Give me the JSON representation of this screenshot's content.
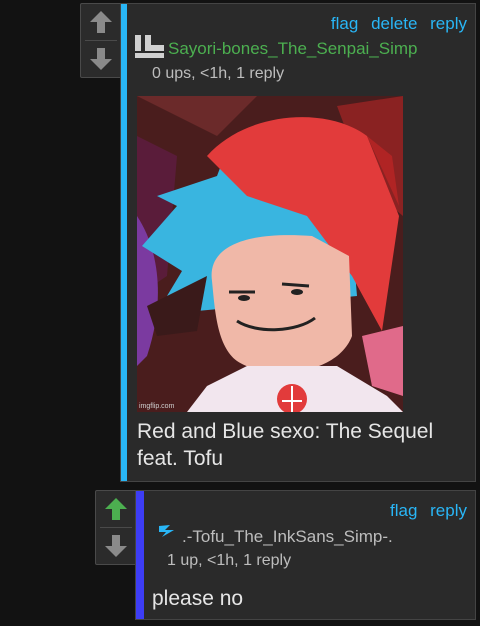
{
  "comment1": {
    "actions": {
      "flag": "flag",
      "delete": "delete",
      "reply": "reply"
    },
    "username": "Sayori-bones_The_Senpai_Simp",
    "meta": "0 ups, <1h, 1 reply",
    "image_watermark": "imgflip.com",
    "text_line1": "Red and Blue sexo: The Sequel",
    "text_line2": "feat. Tofu",
    "colors": {
      "bar": "#29b6f6",
      "username": "#4caf50"
    }
  },
  "comment2": {
    "actions": {
      "flag": "flag",
      "reply": "reply"
    },
    "username": ".-Tofu_The_InkSans_Simp-.",
    "meta": "1 up, <1h, 1 reply",
    "text": "please no",
    "colors": {
      "bar": "#3d3df5",
      "upvote_active": "#4caf50"
    }
  },
  "icons": [
    "arrow-up-icon",
    "arrow-down-icon",
    "user-badge-icon",
    "lightning-icon"
  ]
}
